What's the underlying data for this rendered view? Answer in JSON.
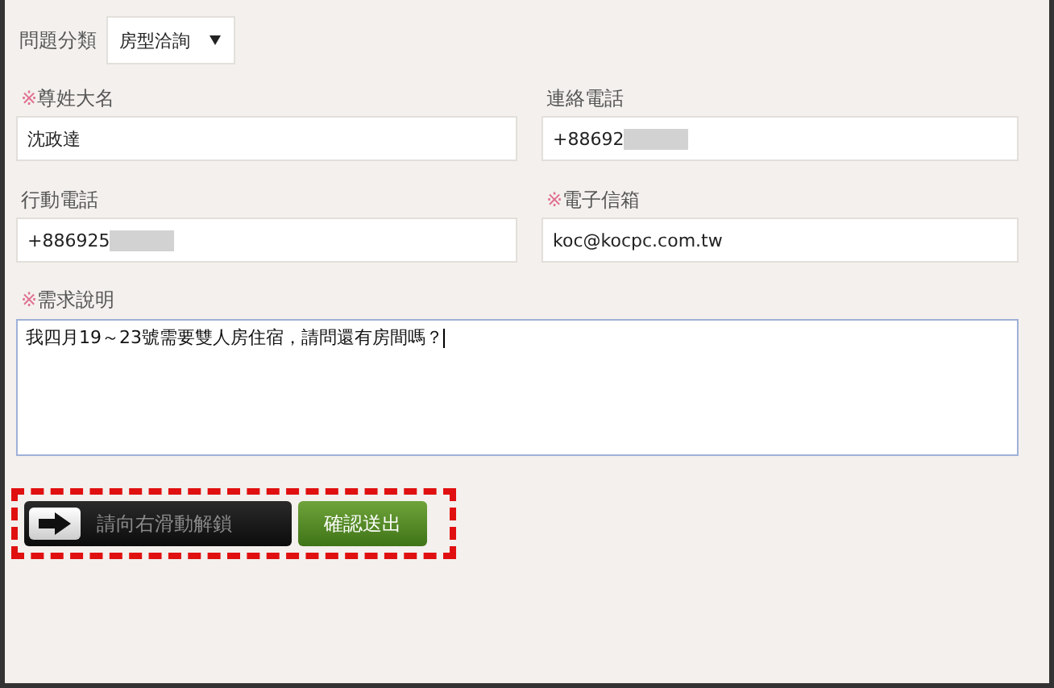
{
  "category": {
    "label": "問題分類",
    "value": "房型洽詢"
  },
  "fields": [
    {
      "mark": "※",
      "label": "尊姓大名",
      "value": "沈政達",
      "redacted": false
    },
    {
      "label": "連絡電話",
      "value": "+88692",
      "redacted": true
    },
    {
      "label": "行動電話",
      "value": "+886925",
      "redacted": true
    },
    {
      "mark": "※",
      "label": "電子信箱",
      "value": "koc@kocpc.com.tw",
      "redacted": false
    }
  ],
  "message": {
    "mark": "※",
    "label": "需求說明",
    "value": "我四月19～23號需要雙人房住宿，請問還有房間嗎？"
  },
  "slider": {
    "label": "請向右滑動解鎖",
    "level": 0
  },
  "submit": {
    "label": "確認送出"
  }
}
